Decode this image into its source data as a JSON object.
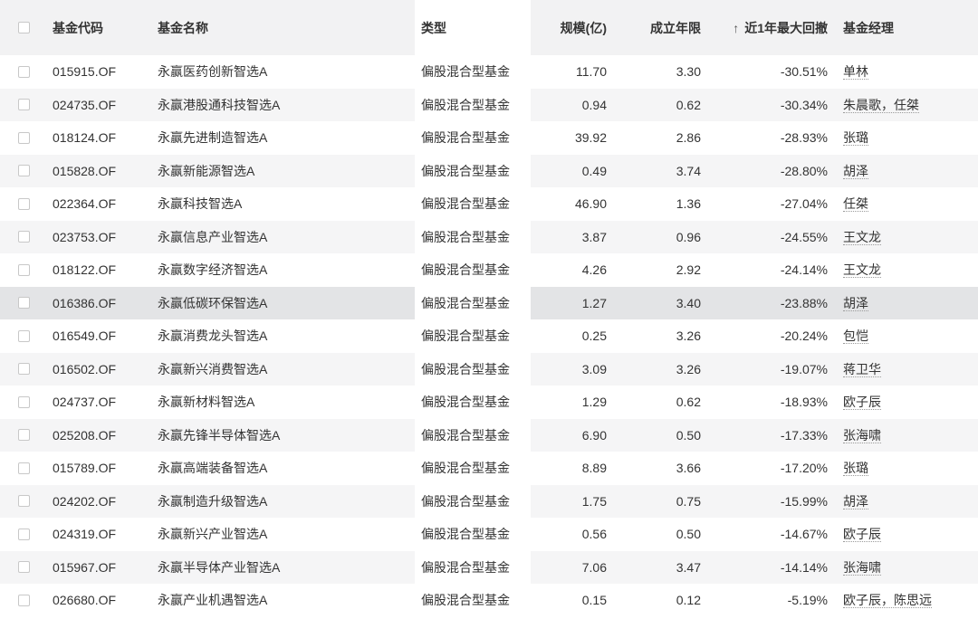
{
  "table": {
    "headers": {
      "code": "基金代码",
      "name": "基金名称",
      "type": "类型",
      "scale": "规模(亿)",
      "years": "成立年限",
      "drawdown": "近1年最大回撤",
      "manager": "基金经理",
      "sort_icon": "↑"
    },
    "rows": [
      {
        "code": "015915.OF",
        "name": "永赢医药创新智选A",
        "type": "偏股混合型基金",
        "scale": "11.70",
        "years": "3.30",
        "drawdown": "-30.51%",
        "manager": "单林"
      },
      {
        "code": "024735.OF",
        "name": "永赢港股通科技智选A",
        "type": "偏股混合型基金",
        "scale": "0.94",
        "years": "0.62",
        "drawdown": "-30.34%",
        "manager": "朱晨歌，任桀"
      },
      {
        "code": "018124.OF",
        "name": "永赢先进制造智选A",
        "type": "偏股混合型基金",
        "scale": "39.92",
        "years": "2.86",
        "drawdown": "-28.93%",
        "manager": "张璐"
      },
      {
        "code": "015828.OF",
        "name": "永赢新能源智选A",
        "type": "偏股混合型基金",
        "scale": "0.49",
        "years": "3.74",
        "drawdown": "-28.80%",
        "manager": "胡泽"
      },
      {
        "code": "022364.OF",
        "name": "永赢科技智选A",
        "type": "偏股混合型基金",
        "scale": "46.90",
        "years": "1.36",
        "drawdown": "-27.04%",
        "manager": "任桀"
      },
      {
        "code": "023753.OF",
        "name": "永赢信息产业智选A",
        "type": "偏股混合型基金",
        "scale": "3.87",
        "years": "0.96",
        "drawdown": "-24.55%",
        "manager": "王文龙"
      },
      {
        "code": "018122.OF",
        "name": "永赢数字经济智选A",
        "type": "偏股混合型基金",
        "scale": "4.26",
        "years": "2.92",
        "drawdown": "-24.14%",
        "manager": "王文龙"
      },
      {
        "code": "016386.OF",
        "name": "永赢低碳环保智选A",
        "type": "偏股混合型基金",
        "scale": "1.27",
        "years": "3.40",
        "drawdown": "-23.88%",
        "manager": "胡泽"
      },
      {
        "code": "016549.OF",
        "name": "永赢消费龙头智选A",
        "type": "偏股混合型基金",
        "scale": "0.25",
        "years": "3.26",
        "drawdown": "-20.24%",
        "manager": "包恺"
      },
      {
        "code": "016502.OF",
        "name": "永赢新兴消费智选A",
        "type": "偏股混合型基金",
        "scale": "3.09",
        "years": "3.26",
        "drawdown": "-19.07%",
        "manager": "蒋卫华"
      },
      {
        "code": "024737.OF",
        "name": "永赢新材料智选A",
        "type": "偏股混合型基金",
        "scale": "1.29",
        "years": "0.62",
        "drawdown": "-18.93%",
        "manager": "欧子辰"
      },
      {
        "code": "025208.OF",
        "name": "永赢先锋半导体智选A",
        "type": "偏股混合型基金",
        "scale": "6.90",
        "years": "0.50",
        "drawdown": "-17.33%",
        "manager": "张海啸"
      },
      {
        "code": "015789.OF",
        "name": "永赢高端装备智选A",
        "type": "偏股混合型基金",
        "scale": "8.89",
        "years": "3.66",
        "drawdown": "-17.20%",
        "manager": "张璐"
      },
      {
        "code": "024202.OF",
        "name": "永赢制造升级智选A",
        "type": "偏股混合型基金",
        "scale": "1.75",
        "years": "0.75",
        "drawdown": "-15.99%",
        "manager": "胡泽"
      },
      {
        "code": "024319.OF",
        "name": "永赢新兴产业智选A",
        "type": "偏股混合型基金",
        "scale": "0.56",
        "years": "0.50",
        "drawdown": "-14.67%",
        "manager": "欧子辰"
      },
      {
        "code": "015967.OF",
        "name": "永赢半导体产业智选A",
        "type": "偏股混合型基金",
        "scale": "7.06",
        "years": "3.47",
        "drawdown": "-14.14%",
        "manager": "张海啸"
      },
      {
        "code": "026680.OF",
        "name": "永赢产业机遇智选A",
        "type": "偏股混合型基金",
        "scale": "0.15",
        "years": "0.12",
        "drawdown": "-5.19%",
        "manager": "欧子辰，陈思远"
      }
    ]
  }
}
